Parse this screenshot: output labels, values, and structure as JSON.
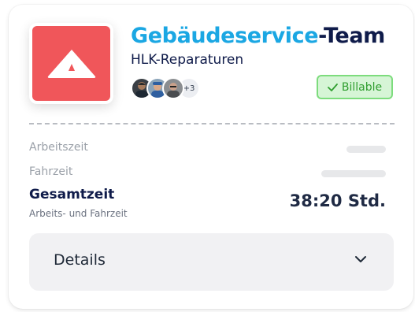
{
  "team": {
    "title_prefix": "Gebäudeservice",
    "title_suffix": "-Team",
    "subtitle": "HLK-Reparaturen",
    "extra_members": "+3",
    "badge_label": "Billable"
  },
  "times": {
    "work_label": "Arbeitszeit",
    "travel_label": "Fahrzeit",
    "total_label": "Gesamtzeit",
    "total_sub": "Arbeits- und Fahrzeit",
    "total_value": "38:20 Std."
  },
  "details": {
    "label": "Details"
  },
  "colors": {
    "brand_red": "#f0565a",
    "title_blue": "#1ba7e3",
    "navy": "#0f1b4a",
    "billable_green": "#2f9e2f"
  },
  "icons": [
    "logo-triangle-icon",
    "check-icon",
    "chevron-down-icon"
  ]
}
